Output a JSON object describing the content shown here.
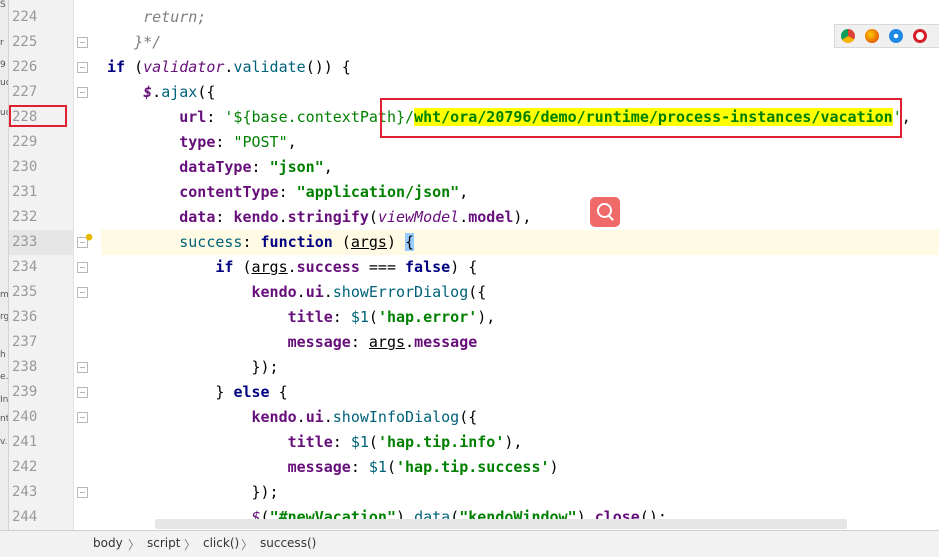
{
  "left_strip": {
    "fragments": [
      "S",
      "r",
      "9",
      "uc",
      "uc",
      "m",
      "rg",
      "h",
      "e.",
      "In",
      "nt",
      "v."
    ]
  },
  "breadcrumb": [
    "body",
    "script",
    "click()",
    "success()"
  ],
  "browser_icons": [
    "chrome-icon",
    "firefox-icon",
    "safari-icon",
    "opera-icon"
  ],
  "lines": [
    {
      "num": "224",
      "parts": [
        {
          "t": "    ",
          "c": ""
        },
        {
          "t": "return;",
          "c": "cm"
        }
      ]
    },
    {
      "num": "225",
      "parts": [
        {
          "t": "   ",
          "c": ""
        },
        {
          "t": "}*/",
          "c": "cm"
        }
      ]
    },
    {
      "num": "226",
      "parts": [
        {
          "t": "if",
          "c": "kw"
        },
        {
          "t": " (",
          "c": ""
        },
        {
          "t": "validator",
          "c": "it"
        },
        {
          "t": ".",
          "c": ""
        },
        {
          "t": "validate",
          "c": "fn"
        },
        {
          "t": "()) {",
          "c": ""
        }
      ]
    },
    {
      "num": "227",
      "parts": [
        {
          "t": "    ",
          "c": ""
        },
        {
          "t": "$",
          "c": "gl"
        },
        {
          "t": ".",
          "c": ""
        },
        {
          "t": "ajax",
          "c": "fn"
        },
        {
          "t": "({",
          "c": ""
        }
      ]
    },
    {
      "num": "228",
      "parts": [
        {
          "t": "        ",
          "c": ""
        },
        {
          "t": "url",
          "c": "prop"
        },
        {
          "t": ": ",
          "c": ""
        },
        {
          "t": "'${base.contextPath}/",
          "c": "strp"
        },
        {
          "t": "wht/ora/20796/demo/runtime/process-instances/vacation",
          "c": "str hl"
        },
        {
          "t": "'",
          "c": "strp"
        },
        {
          "t": ",",
          "c": ""
        }
      ]
    },
    {
      "num": "229",
      "parts": [
        {
          "t": "        ",
          "c": ""
        },
        {
          "t": "type",
          "c": "prop"
        },
        {
          "t": ": ",
          "c": ""
        },
        {
          "t": "\"POST\"",
          "c": "strp"
        },
        {
          "t": ",",
          "c": ""
        }
      ]
    },
    {
      "num": "230",
      "parts": [
        {
          "t": "        ",
          "c": ""
        },
        {
          "t": "dataType",
          "c": "prop"
        },
        {
          "t": ": ",
          "c": ""
        },
        {
          "t": "\"json\"",
          "c": "str"
        },
        {
          "t": ",",
          "c": ""
        }
      ]
    },
    {
      "num": "231",
      "parts": [
        {
          "t": "        ",
          "c": ""
        },
        {
          "t": "contentType",
          "c": "prop"
        },
        {
          "t": ": ",
          "c": ""
        },
        {
          "t": "\"application/json\"",
          "c": "str"
        },
        {
          "t": ",",
          "c": ""
        }
      ]
    },
    {
      "num": "232",
      "parts": [
        {
          "t": "        ",
          "c": ""
        },
        {
          "t": "data",
          "c": "prop"
        },
        {
          "t": ": ",
          "c": ""
        },
        {
          "t": "kendo",
          "c": "prop"
        },
        {
          "t": ".",
          "c": ""
        },
        {
          "t": "stringify",
          "c": "prop"
        },
        {
          "t": "(",
          "c": ""
        },
        {
          "t": "viewModel",
          "c": "it"
        },
        {
          "t": ".",
          "c": ""
        },
        {
          "t": "model",
          "c": "prop"
        },
        {
          "t": "),",
          "c": ""
        }
      ]
    },
    {
      "num": "233",
      "parts": [
        {
          "t": "        ",
          "c": ""
        },
        {
          "t": "success",
          "c": "fn"
        },
        {
          "t": ": ",
          "c": ""
        },
        {
          "t": "function",
          "c": "kw"
        },
        {
          "t": " (",
          "c": ""
        },
        {
          "t": "args",
          "c": "ul"
        },
        {
          "t": ") ",
          "c": ""
        },
        {
          "t": "{",
          "c": "brace-hl"
        }
      ]
    },
    {
      "num": "234",
      "parts": [
        {
          "t": "            ",
          "c": ""
        },
        {
          "t": "if",
          "c": "kw"
        },
        {
          "t": " (",
          "c": ""
        },
        {
          "t": "args",
          "c": "ul"
        },
        {
          "t": ".",
          "c": ""
        },
        {
          "t": "success",
          "c": "prop"
        },
        {
          "t": " === ",
          "c": ""
        },
        {
          "t": "false",
          "c": "kw"
        },
        {
          "t": ") {",
          "c": ""
        }
      ]
    },
    {
      "num": "235",
      "parts": [
        {
          "t": "                ",
          "c": ""
        },
        {
          "t": "kendo",
          "c": "prop"
        },
        {
          "t": ".",
          "c": ""
        },
        {
          "t": "ui",
          "c": "prop"
        },
        {
          "t": ".",
          "c": ""
        },
        {
          "t": "showErrorDialog",
          "c": "fn"
        },
        {
          "t": "({",
          "c": ""
        }
      ]
    },
    {
      "num": "236",
      "parts": [
        {
          "t": "                    ",
          "c": ""
        },
        {
          "t": "title",
          "c": "prop"
        },
        {
          "t": ": ",
          "c": ""
        },
        {
          "t": "$1",
          "c": "fn"
        },
        {
          "t": "(",
          "c": ""
        },
        {
          "t": "'hap.error'",
          "c": "str"
        },
        {
          "t": "),",
          "c": ""
        }
      ]
    },
    {
      "num": "237",
      "parts": [
        {
          "t": "                    ",
          "c": ""
        },
        {
          "t": "message",
          "c": "prop"
        },
        {
          "t": ": ",
          "c": ""
        },
        {
          "t": "args",
          "c": "ul"
        },
        {
          "t": ".",
          "c": ""
        },
        {
          "t": "message",
          "c": "prop"
        }
      ]
    },
    {
      "num": "238",
      "parts": [
        {
          "t": "                ",
          "c": ""
        },
        {
          "t": "});",
          "c": ""
        }
      ]
    },
    {
      "num": "239",
      "parts": [
        {
          "t": "            ",
          "c": ""
        },
        {
          "t": "} ",
          "c": ""
        },
        {
          "t": "else",
          "c": "kw"
        },
        {
          "t": " {",
          "c": ""
        }
      ]
    },
    {
      "num": "240",
      "parts": [
        {
          "t": "                ",
          "c": ""
        },
        {
          "t": "kendo",
          "c": "prop"
        },
        {
          "t": ".",
          "c": ""
        },
        {
          "t": "ui",
          "c": "prop"
        },
        {
          "t": ".",
          "c": ""
        },
        {
          "t": "showInfoDialog",
          "c": "fn"
        },
        {
          "t": "({",
          "c": ""
        }
      ]
    },
    {
      "num": "241",
      "parts": [
        {
          "t": "                    ",
          "c": ""
        },
        {
          "t": "title",
          "c": "prop"
        },
        {
          "t": ": ",
          "c": ""
        },
        {
          "t": "$1",
          "c": "fn"
        },
        {
          "t": "(",
          "c": ""
        },
        {
          "t": "'hap.tip.info'",
          "c": "str"
        },
        {
          "t": "),",
          "c": ""
        }
      ]
    },
    {
      "num": "242",
      "parts": [
        {
          "t": "                    ",
          "c": ""
        },
        {
          "t": "message",
          "c": "prop"
        },
        {
          "t": ": ",
          "c": ""
        },
        {
          "t": "$1",
          "c": "fn"
        },
        {
          "t": "(",
          "c": ""
        },
        {
          "t": "'hap.tip.success'",
          "c": "str"
        },
        {
          "t": ")",
          "c": ""
        }
      ]
    },
    {
      "num": "243",
      "parts": [
        {
          "t": "                ",
          "c": ""
        },
        {
          "t": "});",
          "c": ""
        }
      ]
    },
    {
      "num": "244",
      "parts": [
        {
          "t": "                ",
          "c": ""
        },
        {
          "t": "$",
          "c": "it"
        },
        {
          "t": "(",
          "c": ""
        },
        {
          "t": "\"#newVacation\"",
          "c": "str"
        },
        {
          "t": ").",
          "c": ""
        },
        {
          "t": "data",
          "c": "fn"
        },
        {
          "t": "(",
          "c": ""
        },
        {
          "t": "\"kendoWindow\"",
          "c": "str"
        },
        {
          "t": ").",
          "c": ""
        },
        {
          "t": "close",
          "c": "prop"
        },
        {
          "t": "();",
          "c": ""
        }
      ]
    }
  ]
}
